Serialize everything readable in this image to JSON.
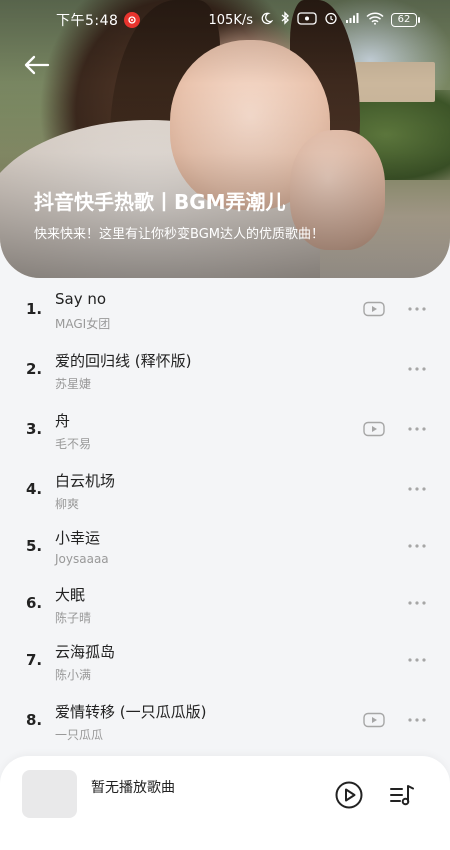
{
  "status_bar": {
    "time": "下午5:48",
    "speed": "105K/s",
    "battery": "62"
  },
  "header": {
    "title": "抖音快手热歌丨BGM弄潮儿",
    "subtitle": "快来快来！这里有让你秒变BGM达人的优质歌曲！"
  },
  "songs": [
    {
      "num": "1.",
      "title": "Say no",
      "artist": "MAGI女团",
      "has_mv": true
    },
    {
      "num": "2.",
      "title": "爱的回归线 (释怀版)",
      "artist": "苏星婕",
      "has_mv": false
    },
    {
      "num": "3.",
      "title": "舟",
      "artist": "毛不易",
      "has_mv": true
    },
    {
      "num": "4.",
      "title": "白云机场",
      "artist": "柳爽",
      "has_mv": false
    },
    {
      "num": "5.",
      "title": "小幸运",
      "artist": "Joysaaaa",
      "has_mv": false
    },
    {
      "num": "6.",
      "title": "大眠",
      "artist": "陈子晴",
      "has_mv": false
    },
    {
      "num": "7.",
      "title": "云海孤岛",
      "artist": "陈小满",
      "has_mv": false
    },
    {
      "num": "8.",
      "title": "爱情转移 (一只瓜瓜版)",
      "artist": "一只瓜瓜",
      "has_mv": true
    }
  ],
  "player": {
    "now_playing": "暂无播放歌曲"
  },
  "icons": {
    "back": "back-arrow-icon",
    "mv": "video-icon",
    "more": "more-icon",
    "play": "play-icon",
    "playlist": "playlist-icon"
  },
  "colors": {
    "background": "#f4f5f7",
    "title_text": "#222222",
    "artist_text": "#999999",
    "icon_gray": "#a6a6a6",
    "netease_red": "#e8342e"
  }
}
